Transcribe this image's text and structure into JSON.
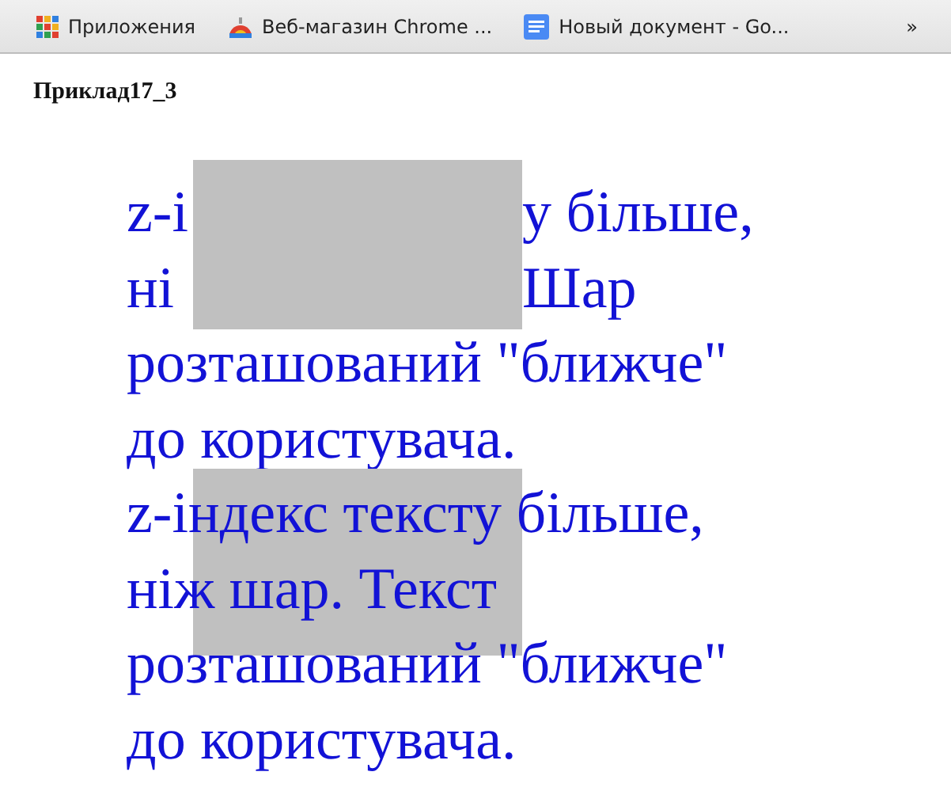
{
  "bookmarks": [
    {
      "label": "Приложения",
      "kind": "apps"
    },
    {
      "label": "Веб-магазин Chrome ...",
      "kind": "store"
    },
    {
      "label": "Новый документ - Go...",
      "kind": "doc"
    }
  ],
  "overflow": "»",
  "page": {
    "title": "Приклад17_3",
    "covered_text": {
      "lines": [
        {
          "left": "z-i",
          "right": "у більше,"
        },
        {
          "left": "ні",
          "right": "Шар"
        }
      ],
      "rest": [
        "розташований \"ближче\"",
        "до користувача."
      ]
    },
    "over_text": [
      "z-індекс тексту більше,",
      "ніж шар. Текст",
      "розташований \"ближче\"",
      "до користувача."
    ]
  }
}
